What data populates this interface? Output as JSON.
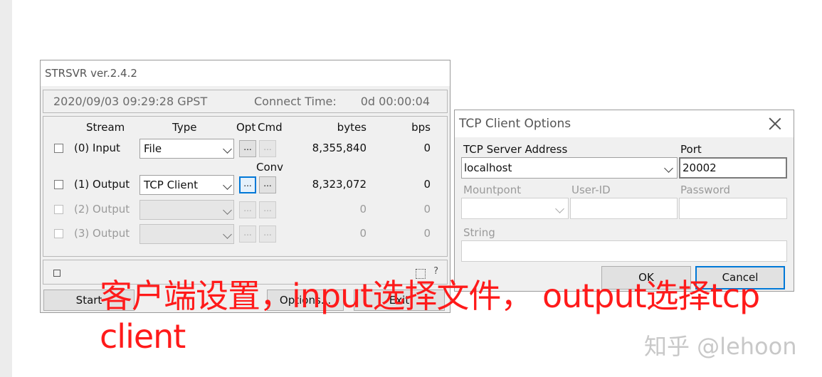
{
  "strsvr": {
    "title": "STRSVR ver.2.4.2",
    "datetime": "2020/09/03 09:29:28 GPST",
    "connect_label": "Connect Time:",
    "connect_time": "0d 00:00:04",
    "headers": {
      "stream": "Stream",
      "type": "Type",
      "opt": "Opt",
      "cmd": "Cmd",
      "bytes": "bytes",
      "bps": "bps"
    },
    "conv_label": "Conv",
    "btn_dots": "...",
    "rows": [
      {
        "label": "(0) Input",
        "type": "File",
        "bytes": "8,355,840",
        "bps": "0"
      },
      {
        "label": "(1) Output",
        "type": "TCP Client",
        "bytes": "8,323,072",
        "bps": "0"
      },
      {
        "label": "(2) Output",
        "type": "",
        "bytes": "0",
        "bps": "0"
      },
      {
        "label": "(3) Output",
        "type": "",
        "bytes": "0",
        "bps": "0"
      }
    ],
    "buttons": {
      "start": "Start",
      "options": "Options...",
      "exit": "Exit"
    },
    "help": "?"
  },
  "tcp_dialog": {
    "title": "TCP Client Options",
    "server_label": "TCP Server Address",
    "server_value": "localhost",
    "port_label": "Port",
    "port_value": "20002",
    "mountpoint_label": "Mountpont",
    "userid_label": "User-ID",
    "password_label": "Password",
    "string_label": "String",
    "ok": "OK",
    "cancel": "Cancel"
  },
  "annotation": {
    "text": "客户端设置，input选择文件， output选择tcp client"
  },
  "watermark": "知乎 @lehoon",
  "colors": {
    "annotation": "#ff1a1a",
    "focus": "#0078d7"
  }
}
